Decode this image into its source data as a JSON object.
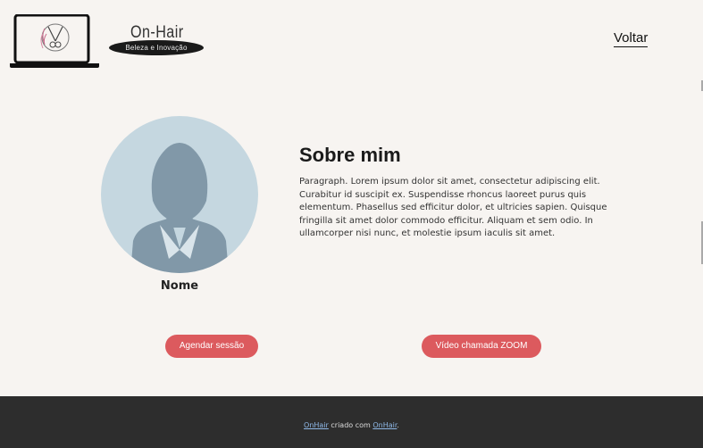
{
  "header": {
    "brand_name": "On-Hair",
    "brand_tagline": "Beleza e Inovação",
    "nav_back": "Voltar"
  },
  "profile": {
    "name": "Nome"
  },
  "about": {
    "title": "Sobre mim",
    "text": "Paragraph. Lorem ipsum dolor sit amet, consectetur adipiscing elit. Curabitur id suscipit ex. Suspendisse rhoncus laoreet purus quis elementum. Phasellus sed efficitur dolor, et ultricies sapien. Quisque fringilla sit amet dolor commodo efficitur. Aliquam et sem odio. In ullamcorper nisi nunc, et molestie ipsum iaculis sit amet."
  },
  "actions": {
    "schedule_label": "Agendar sessão",
    "zoom_label": "Vídeo chamada ZOOM"
  },
  "footer": {
    "link1": "OnHair",
    "middle": " criado com ",
    "link2": "OnHair",
    "end": "."
  },
  "colors": {
    "background": "#f7f4f1",
    "accent": "#dc5a5e",
    "footer": "#2d2d2d",
    "avatar_bg": "#c5d7e0",
    "avatar_figure": "#8198a8"
  }
}
